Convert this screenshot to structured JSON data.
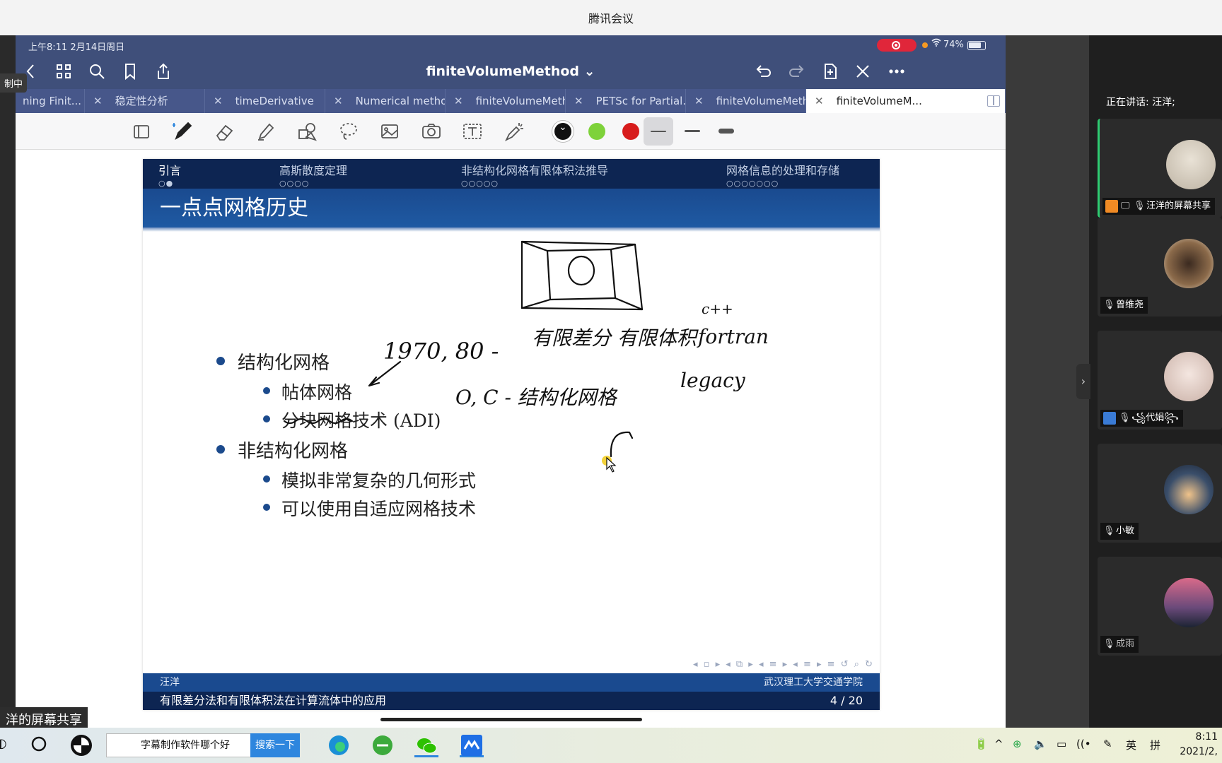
{
  "window": {
    "title": "腾讯会议"
  },
  "recording_badge": "制中",
  "ipad": {
    "status": {
      "datetime": "上午8:11   2月14日周日",
      "battery": "74%"
    },
    "nav": {
      "title": "finiteVolumeMethod ⌄"
    },
    "tabs": [
      {
        "label": "ning Finit..."
      },
      {
        "label": "稳定性分析"
      },
      {
        "label": "timeDerivative"
      },
      {
        "label": "Numerical method..."
      },
      {
        "label": "finiteVolumeMethod"
      },
      {
        "label": "PETSc for Partial..."
      },
      {
        "label": "finiteVolumeMeth..."
      },
      {
        "label": "finiteVolumeM..."
      }
    ],
    "toolbar": {
      "colors": [
        "#111111",
        "#7ed23a",
        "#d71c1c"
      ]
    }
  },
  "slide": {
    "sections": [
      {
        "label": "引言",
        "dots": "○●"
      },
      {
        "label": "高斯散度定理",
        "dots": "○○○○"
      },
      {
        "label": "非结构化网格有限体积法推导",
        "dots": "○○○○○"
      },
      {
        "label": "网格信息的处理和存储",
        "dots": "○○○○○○○"
      }
    ],
    "title": "一点点网格历史",
    "bullets": [
      {
        "text": "结构化网格",
        "children": [
          "帖体网格",
          "分块网格技术 (ADI)"
        ]
      },
      {
        "text": "非结构化网格",
        "children": [
          "模拟非常复杂的几何形式",
          "可以使用自适应网格技术"
        ]
      }
    ],
    "footer": {
      "author": "汪洋",
      "institution": "武汉理工大学交通学院",
      "talk_title": "有限差分法和有限体积法在计算流体中的应用",
      "page": "4 / 20"
    },
    "handwriting": [
      "1970, 80 -",
      "有限差分 有限体积",
      "c++",
      "fortran",
      "legacy",
      "O, C - 结构化网格"
    ]
  },
  "meeting": {
    "speaking": "正在讲话: 汪洋;",
    "participants": [
      {
        "name": "汪洋的屏幕共享"
      },
      {
        "name": "曾维尧"
      },
      {
        "name": "꧁代娟꧂"
      },
      {
        "name": "小敏"
      },
      {
        "name": "成雨"
      }
    ],
    "share_banner": "洋的屏幕共享"
  },
  "taskbar": {
    "search_text": "字幕制作软件哪个好",
    "search_button": "搜索一下",
    "ime": "英",
    "ime2": "拼",
    "time": "8:11",
    "date": "2021/2,"
  }
}
